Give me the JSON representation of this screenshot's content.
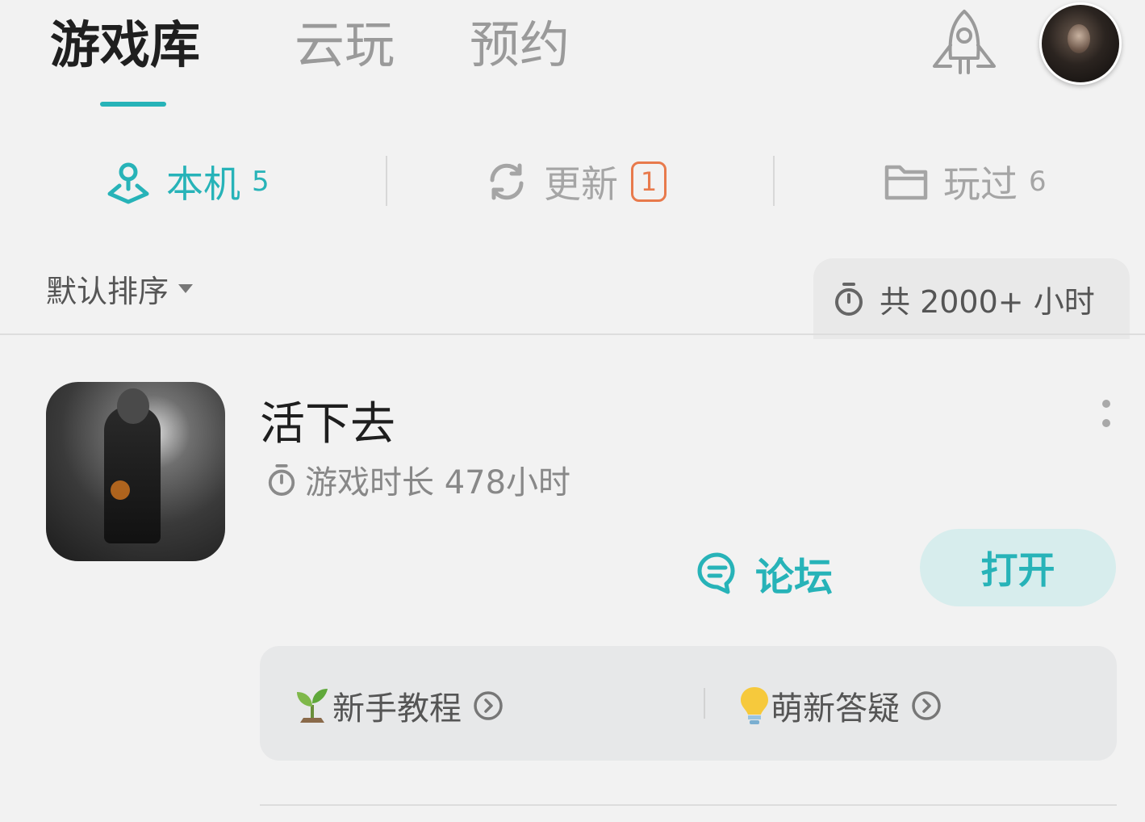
{
  "top_tabs": {
    "library": "游戏库",
    "cloud": "云玩",
    "reserve": "预约"
  },
  "sub_tabs": {
    "local": {
      "label": "本机",
      "count": "5"
    },
    "update": {
      "label": "更新",
      "badge": "1"
    },
    "played": {
      "label": "玩过",
      "count": "6"
    }
  },
  "sort": {
    "label": "默认排序"
  },
  "total_time": "共 2000+ 小时",
  "game": {
    "title": "活下去",
    "play_time": "游戏时长 478小时",
    "forum_label": "论坛",
    "open_label": "打开"
  },
  "help": {
    "tutorial": "新手教程",
    "qa": "萌新答疑"
  },
  "colors": {
    "accent": "#27b3b8",
    "badge": "#e87a4c",
    "background": "#f2f2f2",
    "inactive": "#9a9a9a"
  },
  "icons": [
    "rocket-icon",
    "location-pin-icon",
    "refresh-icon",
    "folder-icon",
    "stopwatch-icon",
    "more-vertical-icon",
    "forum-chat-icon",
    "sprout-icon",
    "lightbulb-icon",
    "arrow-right-circle-icon"
  ]
}
